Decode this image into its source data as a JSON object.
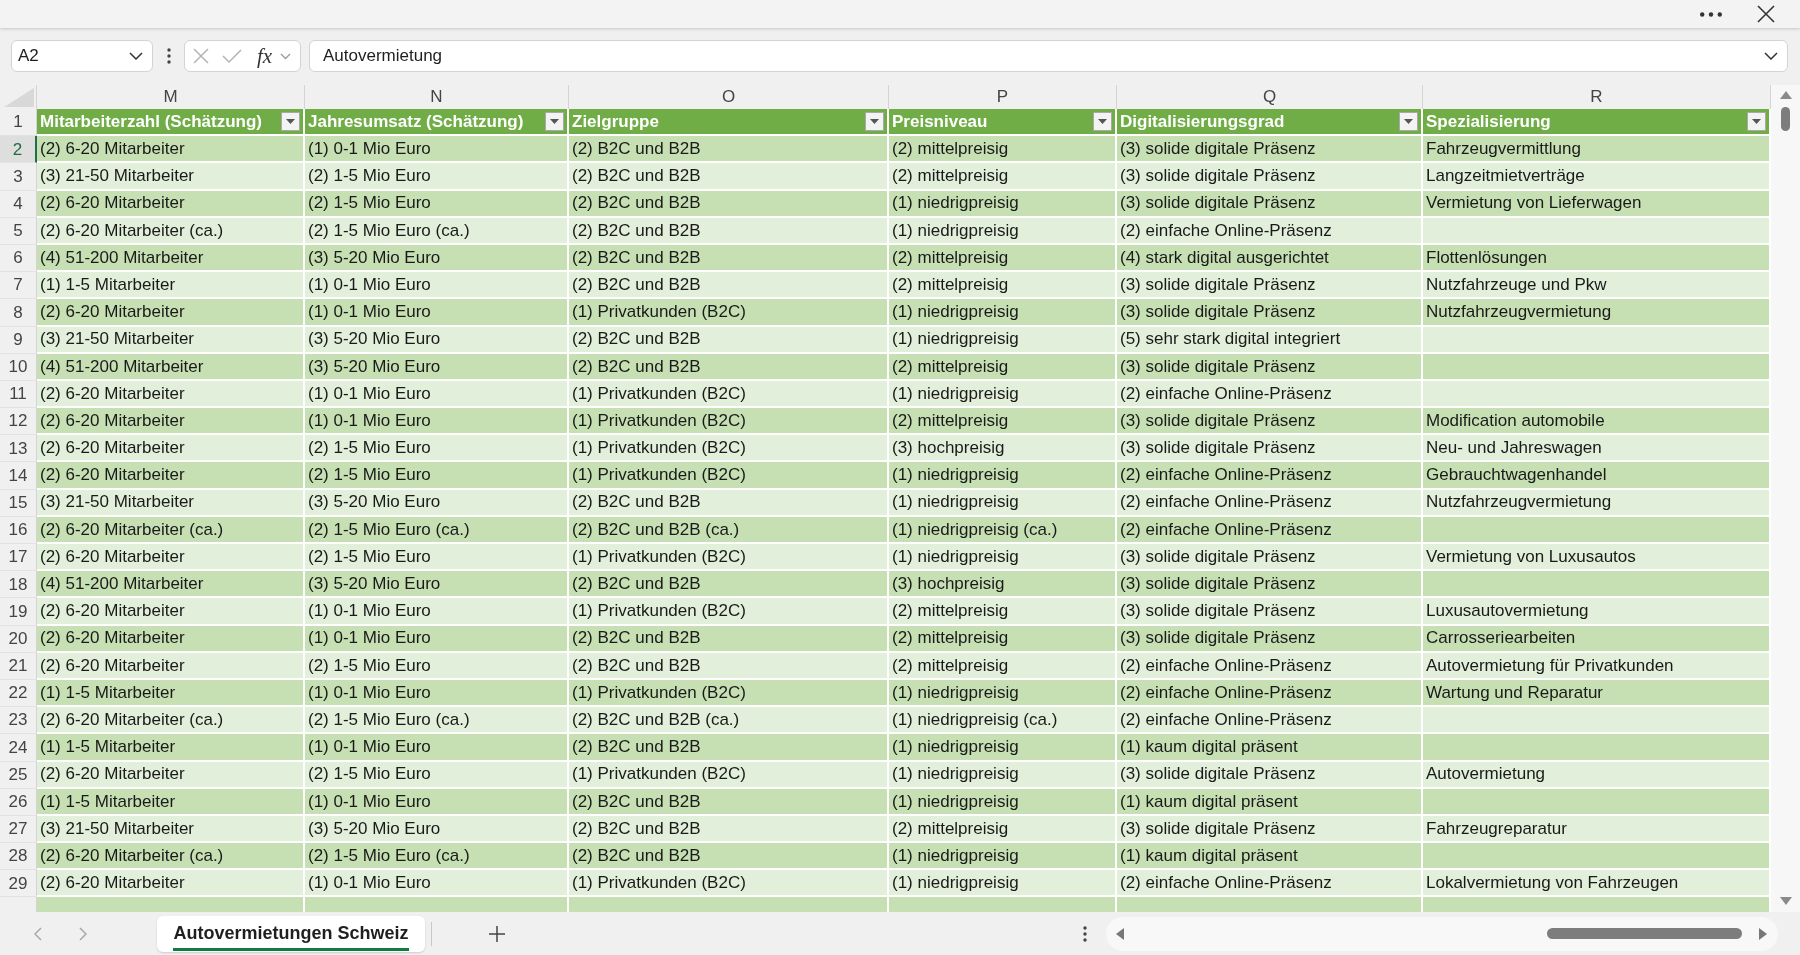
{
  "formula_bar": {
    "name_box": "A2",
    "function_label": "fx",
    "value": "Autovermietung"
  },
  "sheet": {
    "column_letters": [
      "M",
      "N",
      "O",
      "P",
      "Q",
      "R"
    ],
    "header_row": {
      "number": "1",
      "selected": false,
      "cells": [
        "Mitarbeiterzahl (Schätzung)",
        "Jahresumsatz (Schätzung)",
        "Zielgruppe",
        "Preisniveau",
        "Digitalisierungsgrad",
        "Spezialisierung"
      ]
    },
    "rows": [
      {
        "number": "2",
        "selected": true,
        "cells": [
          "(2) 6-20 Mitarbeiter",
          "(1) 0-1 Mio Euro",
          "(2) B2C und B2B",
          "(2) mittelpreisig",
          "(3) solide digitale Präsenz",
          "Fahrzeugvermittlung"
        ]
      },
      {
        "number": "3",
        "selected": false,
        "cells": [
          "(3) 21-50 Mitarbeiter",
          "(2) 1-5 Mio Euro",
          "(2) B2C und B2B",
          "(2) mittelpreisig",
          "(3) solide digitale Präsenz",
          "Langzeitmietverträge"
        ]
      },
      {
        "number": "4",
        "selected": false,
        "cells": [
          "(2) 6-20 Mitarbeiter",
          "(2) 1-5 Mio Euro",
          "(2) B2C und B2B",
          "(1) niedrigpreisig",
          "(3) solide digitale Präsenz",
          "Vermietung von Lieferwagen"
        ]
      },
      {
        "number": "5",
        "selected": false,
        "cells": [
          "(2) 6-20 Mitarbeiter (ca.)",
          "(2) 1-5 Mio Euro (ca.)",
          "(2) B2C und B2B",
          "(1) niedrigpreisig",
          "(2) einfache Online-Präsenz"
        ]
      },
      {
        "number": "6",
        "selected": false,
        "cells": [
          "(4) 51-200 Mitarbeiter",
          "(3) 5-20 Mio Euro",
          "(2) B2C und B2B",
          "(2) mittelpreisig",
          "(4) stark digital ausgerichtet",
          "Flottenlösungen"
        ]
      },
      {
        "number": "7",
        "selected": false,
        "cells": [
          "(1) 1-5 Mitarbeiter",
          "(1) 0-1 Mio Euro",
          "(2) B2C und B2B",
          "(2) mittelpreisig",
          "(3) solide digitale Präsenz",
          "Nutzfahrzeuge und Pkw"
        ]
      },
      {
        "number": "8",
        "selected": false,
        "cells": [
          "(2) 6-20 Mitarbeiter",
          "(1) 0-1 Mio Euro",
          "(1) Privatkunden (B2C)",
          "(1) niedrigpreisig",
          "(3) solide digitale Präsenz",
          "Nutzfahrzeugvermietung"
        ]
      },
      {
        "number": "9",
        "selected": false,
        "cells": [
          "(3) 21-50 Mitarbeiter",
          "(3) 5-20 Mio Euro",
          "(2) B2C und B2B",
          "(1) niedrigpreisig",
          "(5) sehr stark digital integriert"
        ]
      },
      {
        "number": "10",
        "selected": false,
        "cells": [
          "(4) 51-200 Mitarbeiter",
          "(3) 5-20 Mio Euro",
          "(2) B2C und B2B",
          "(2) mittelpreisig",
          "(3) solide digitale Präsenz"
        ]
      },
      {
        "number": "11",
        "selected": false,
        "cells": [
          "(2) 6-20 Mitarbeiter",
          "(1) 0-1 Mio Euro",
          "(1) Privatkunden (B2C)",
          "(1) niedrigpreisig",
          "(2) einfache Online-Präsenz"
        ]
      },
      {
        "number": "12",
        "selected": false,
        "cells": [
          "(2) 6-20 Mitarbeiter",
          "(1) 0-1 Mio Euro",
          "(1) Privatkunden (B2C)",
          "(2) mittelpreisig",
          "(3) solide digitale Präsenz",
          "Modification automobile"
        ]
      },
      {
        "number": "13",
        "selected": false,
        "cells": [
          "(2) 6-20 Mitarbeiter",
          "(2) 1-5 Mio Euro",
          "(1) Privatkunden (B2C)",
          "(3) hochpreisig",
          "(3) solide digitale Präsenz",
          "Neu- und Jahreswagen"
        ]
      },
      {
        "number": "14",
        "selected": false,
        "cells": [
          "(2) 6-20 Mitarbeiter",
          "(2) 1-5 Mio Euro",
          "(1) Privatkunden (B2C)",
          "(1) niedrigpreisig",
          "(2) einfache Online-Präsenz",
          "Gebrauchtwagenhandel"
        ]
      },
      {
        "number": "15",
        "selected": false,
        "cells": [
          "(3) 21-50 Mitarbeiter",
          "(3) 5-20 Mio Euro",
          "(2) B2C und B2B",
          "(1) niedrigpreisig",
          "(2) einfache Online-Präsenz",
          "Nutzfahrzeugvermietung"
        ]
      },
      {
        "number": "16",
        "selected": false,
        "cells": [
          "(2) 6-20 Mitarbeiter (ca.)",
          "(2) 1-5 Mio Euro (ca.)",
          "(2) B2C und B2B (ca.)",
          "(1) niedrigpreisig (ca.)",
          "(2) einfache Online-Präsenz"
        ]
      },
      {
        "number": "17",
        "selected": false,
        "cells": [
          "(2) 6-20 Mitarbeiter",
          "(2) 1-5 Mio Euro",
          "(1) Privatkunden (B2C)",
          "(1) niedrigpreisig",
          "(3) solide digitale Präsenz",
          "Vermietung von Luxusautos"
        ]
      },
      {
        "number": "18",
        "selected": false,
        "cells": [
          "(4) 51-200 Mitarbeiter",
          "(3) 5-20 Mio Euro",
          "(2) B2C und B2B",
          "(3) hochpreisig",
          "(3) solide digitale Präsenz"
        ]
      },
      {
        "number": "19",
        "selected": false,
        "cells": [
          "(2) 6-20 Mitarbeiter",
          "(1) 0-1 Mio Euro",
          "(1) Privatkunden (B2C)",
          "(2) mittelpreisig",
          "(3) solide digitale Präsenz",
          "Luxusautovermietung"
        ]
      },
      {
        "number": "20",
        "selected": false,
        "cells": [
          "(2) 6-20 Mitarbeiter",
          "(1) 0-1 Mio Euro",
          "(2) B2C und B2B",
          "(2) mittelpreisig",
          "(3) solide digitale Präsenz",
          "Carrosseriearbeiten"
        ]
      },
      {
        "number": "21",
        "selected": false,
        "cells": [
          "(2) 6-20 Mitarbeiter",
          "(2) 1-5 Mio Euro",
          "(2) B2C und B2B",
          "(2) mittelpreisig",
          "(2) einfache Online-Präsenz",
          "Autovermietung für Privatkunden"
        ]
      },
      {
        "number": "22",
        "selected": false,
        "cells": [
          "(1) 1-5 Mitarbeiter",
          "(1) 0-1 Mio Euro",
          "(1) Privatkunden (B2C)",
          "(1) niedrigpreisig",
          "(2) einfache Online-Präsenz",
          "Wartung und Reparatur"
        ]
      },
      {
        "number": "23",
        "selected": false,
        "cells": [
          "(2) 6-20 Mitarbeiter (ca.)",
          "(2) 1-5 Mio Euro (ca.)",
          "(2) B2C und B2B (ca.)",
          "(1) niedrigpreisig (ca.)",
          "(2) einfache Online-Präsenz"
        ]
      },
      {
        "number": "24",
        "selected": false,
        "cells": [
          "(1) 1-5 Mitarbeiter",
          "(1) 0-1 Mio Euro",
          "(2) B2C und B2B",
          "(1) niedrigpreisig",
          "(1) kaum digital präsent"
        ]
      },
      {
        "number": "25",
        "selected": false,
        "cells": [
          "(2) 6-20 Mitarbeiter",
          "(2) 1-5 Mio Euro",
          "(1) Privatkunden (B2C)",
          "(1) niedrigpreisig",
          "(3) solide digitale Präsenz",
          "Autovermietung"
        ]
      },
      {
        "number": "26",
        "selected": false,
        "cells": [
          "(1) 1-5 Mitarbeiter",
          "(1) 0-1 Mio Euro",
          "(2) B2C und B2B",
          "(1) niedrigpreisig",
          "(1) kaum digital präsent"
        ]
      },
      {
        "number": "27",
        "selected": false,
        "cells": [
          "(3) 21-50 Mitarbeiter",
          "(3) 5-20 Mio Euro",
          "(2) B2C und B2B",
          "(2) mittelpreisig",
          "(3) solide digitale Präsenz",
          "Fahrzeugreparatur"
        ]
      },
      {
        "number": "28",
        "selected": false,
        "cells": [
          "(2) 6-20 Mitarbeiter (ca.)",
          "(2) 1-5 Mio Euro (ca.)",
          "(2) B2C und B2B",
          "(1) niedrigpreisig",
          "(1) kaum digital präsent"
        ]
      },
      {
        "number": "29",
        "selected": false,
        "cells": [
          "(2) 6-20 Mitarbeiter",
          "(1) 0-1 Mio Euro",
          "(1) Privatkunden (B2C)",
          "(1) niedrigpreisig",
          "(2) einfache Online-Präsenz",
          "Lokalvermietung von Fahrzeugen"
        ]
      }
    ]
  },
  "sheet_tabs": [
    {
      "label": "Autovermietungen Schweiz",
      "selected": true
    }
  ]
}
